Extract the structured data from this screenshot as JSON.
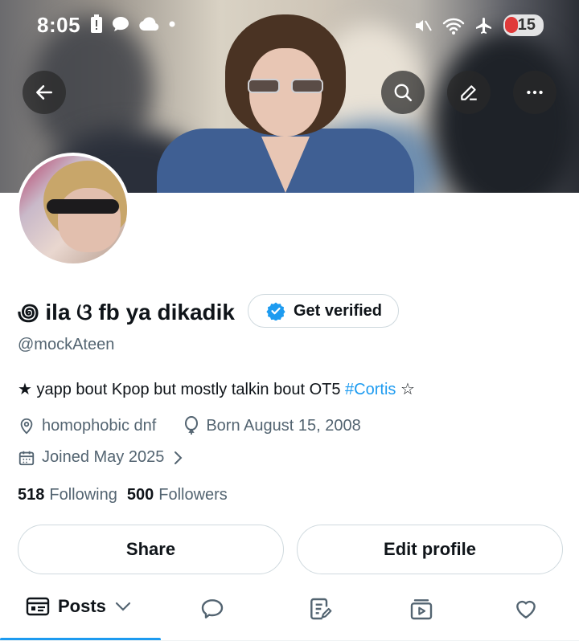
{
  "status_bar": {
    "time": "8:05",
    "battery": "15"
  },
  "profile": {
    "display_name": "꩜ ila ଓ fb ya dikadik",
    "get_verified_label": "Get verified",
    "handle": "@mockAteen",
    "bio_text": "★ yapp bout Kpop but mostly talkin bout OT5 ",
    "bio_hashtag": "#Cortis",
    "bio_end": " ☆",
    "location": "homophobic dnf",
    "birthday": "Born August 15, 2008",
    "joined": "Joined May 2025",
    "following_count": "518",
    "following_label": "Following",
    "followers_count": "500",
    "followers_label": "Followers"
  },
  "actions": {
    "share_label": "Share",
    "edit_profile_label": "Edit profile"
  },
  "tabs": {
    "posts_label": "Posts"
  },
  "colors": {
    "accent": "#1d9bf0",
    "secondary_text": "#536471",
    "primary_text": "#0f1419"
  },
  "icons": [
    "back-arrow-icon",
    "search-icon",
    "edit-pencil-icon",
    "more-icon",
    "verified-badge-icon",
    "location-icon",
    "balloon-icon",
    "calendar-icon",
    "chevron-right-icon",
    "posts-icon",
    "chevron-down-icon",
    "replies-icon",
    "highlights-icon",
    "media-icon",
    "likes-icon"
  ]
}
